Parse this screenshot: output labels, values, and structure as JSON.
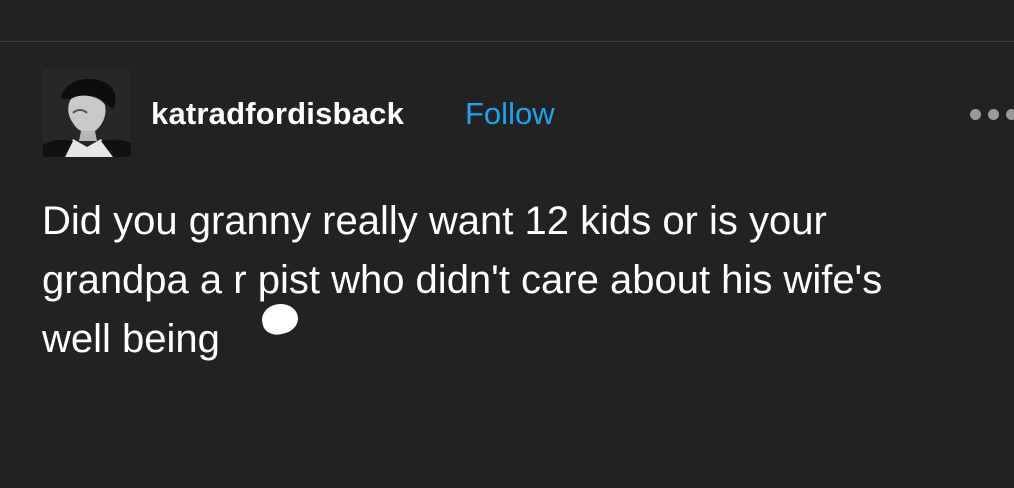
{
  "post": {
    "username": "katradfordisback",
    "follow_label": "Follow",
    "more_menu_icon": "more-horizontal-icon",
    "avatar_icon": "profile-photo-avatar",
    "body_lines": [
      "Did you granny really want 12 kids or is your",
      "grandpa a r pist who didn't care about his wife's",
      "well being"
    ]
  },
  "colors": {
    "background": "#222222",
    "text": "#ffffff",
    "link": "#1ea2ec",
    "menu_dots": "#9a9a9a"
  }
}
